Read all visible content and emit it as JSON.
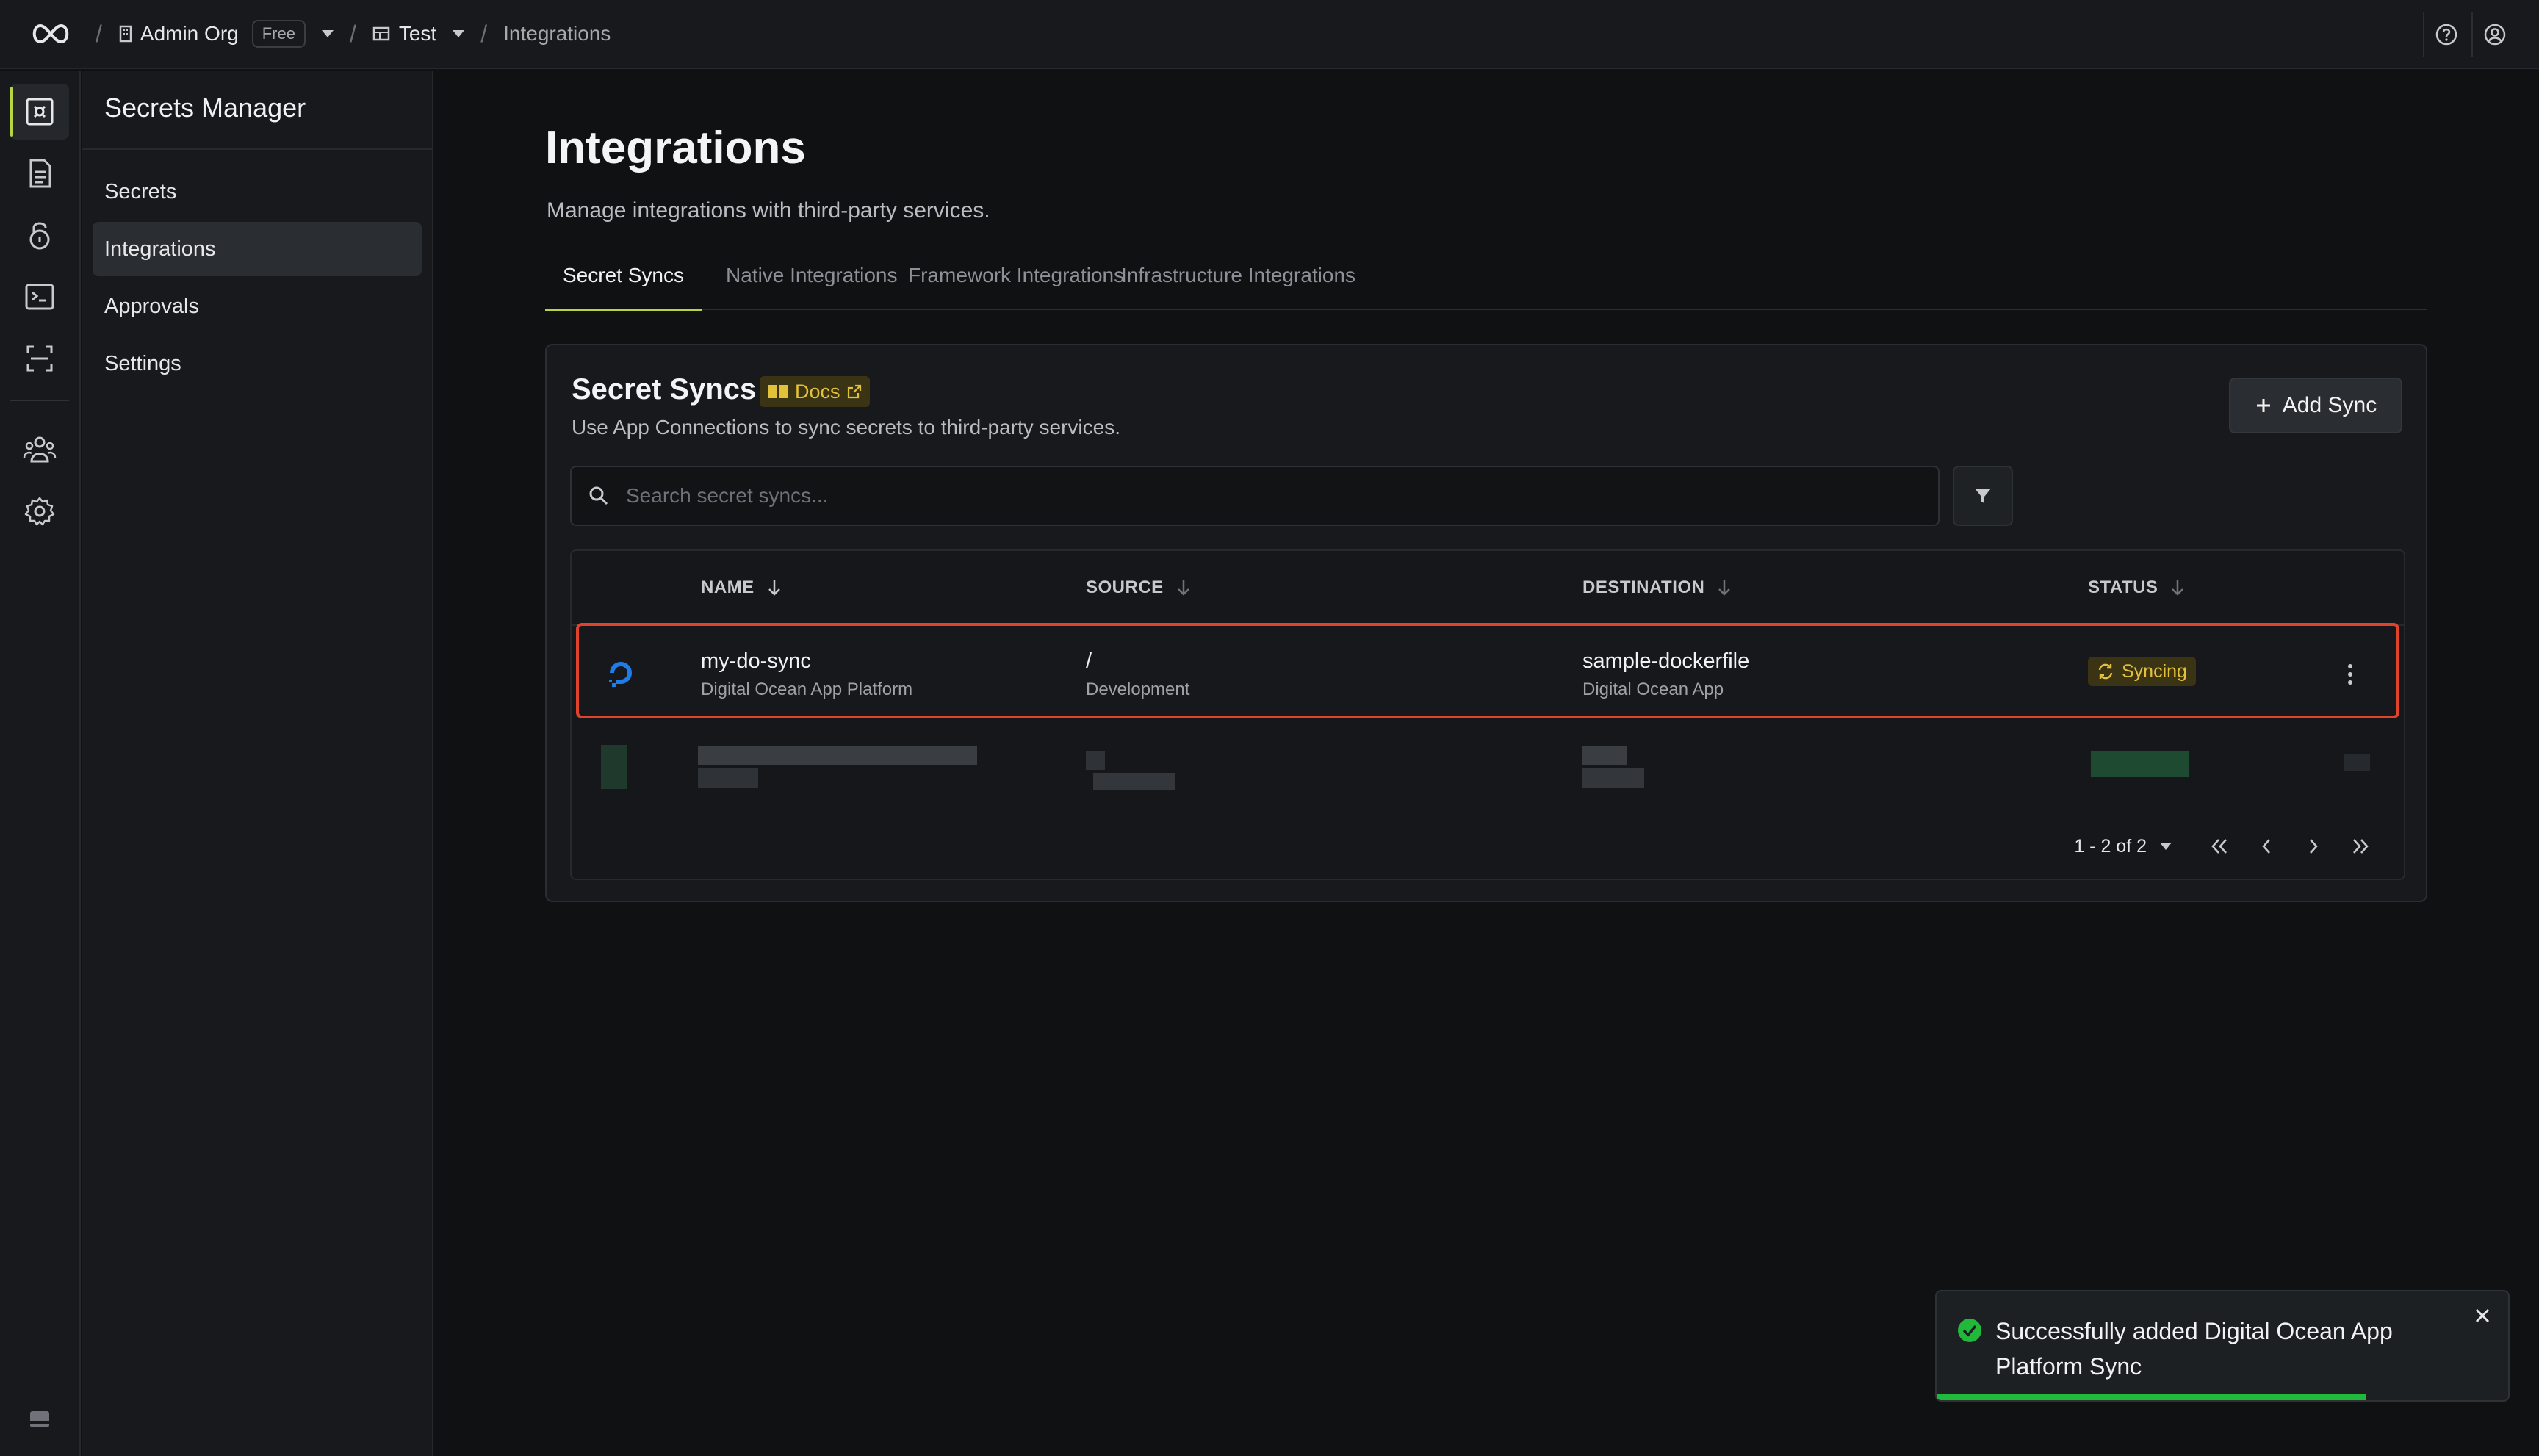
{
  "topbar": {
    "org_name": "Admin Org",
    "plan_badge": "Free",
    "project_name": "Test",
    "current_page": "Integrations",
    "separator": "/"
  },
  "sidebar": {
    "title": "Secrets Manager",
    "items": [
      {
        "label": "Secrets",
        "active": false
      },
      {
        "label": "Integrations",
        "active": true
      },
      {
        "label": "Approvals",
        "active": false
      },
      {
        "label": "Settings",
        "active": false
      }
    ]
  },
  "rail": {
    "icons": [
      "secrets-manager-icon",
      "document-icon",
      "lock-icon",
      "terminal-icon",
      "scan-icon",
      "users-icon",
      "settings-gear-icon",
      "panel-icon"
    ],
    "accent_color": "#b6d53f"
  },
  "page": {
    "title": "Integrations",
    "subtitle": "Manage integrations with third-party services."
  },
  "tabs": [
    {
      "label": "Secret Syncs",
      "active": true
    },
    {
      "label": "Native Integrations",
      "active": false
    },
    {
      "label": "Framework Integrations",
      "active": false
    },
    {
      "label": "Infrastructure Integrations",
      "active": false
    }
  ],
  "card": {
    "title": "Secret Syncs",
    "docs_label": "Docs",
    "subtitle": "Use App Connections to sync secrets to third-party services.",
    "add_button": "Add Sync",
    "search_placeholder": "Search secret syncs..."
  },
  "table": {
    "columns": [
      "NAME",
      "SOURCE",
      "DESTINATION",
      "STATUS"
    ],
    "rows": [
      {
        "name": "my-do-sync",
        "name_sub": "Digital Ocean App Platform",
        "source": "/",
        "source_sub": "Development",
        "destination": "sample-dockerfile",
        "destination_sub": "Digital Ocean App",
        "status": "Syncing"
      }
    ],
    "pagination": "1 - 2 of 2"
  },
  "toast": {
    "message": "Successfully added Digital Ocean App Platform Sync",
    "progress": 0.75,
    "success_color": "#20b93a"
  },
  "colors": {
    "highlight_border": "#e0432c",
    "warning_badge": "#e3c13a"
  }
}
